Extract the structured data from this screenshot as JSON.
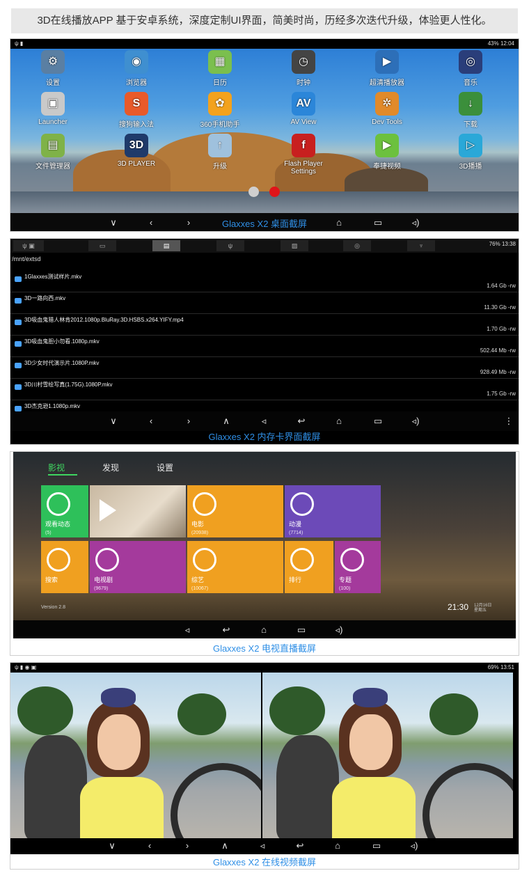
{
  "header": {
    "text": "3D在线播放APP 基于安卓系统，深度定制UI界面，简美时尚，历经多次迭代升级，体验更人性化。"
  },
  "desktop": {
    "status_right": "43% 12:04",
    "apps": [
      {
        "label": "设置",
        "icon": "gear-icon",
        "color": "#5a7fa3",
        "glyph": "⚙"
      },
      {
        "label": "浏览器",
        "icon": "globe-icon",
        "color": "#3f8fd0",
        "glyph": "◉"
      },
      {
        "label": "日历",
        "icon": "calendar-icon",
        "color": "#7bbf4e",
        "glyph": "▦"
      },
      {
        "label": "时钟",
        "icon": "clock-icon",
        "color": "#444444",
        "glyph": "◷"
      },
      {
        "label": "超清播放器",
        "icon": "clapper-icon",
        "color": "#2d6fb8",
        "glyph": "▶"
      },
      {
        "label": "音乐",
        "icon": "speaker-icon",
        "color": "#2a3e7a",
        "glyph": "◎"
      },
      {
        "label": "Launcher",
        "icon": "launcher-icon",
        "color": "#c9c9c9",
        "glyph": "▣"
      },
      {
        "label": "搜狗输入法",
        "icon": "sogou-icon",
        "color": "#e85a2a",
        "glyph": "S"
      },
      {
        "label": "360手机助手",
        "icon": "360-icon",
        "color": "#f3a21d",
        "glyph": "✿"
      },
      {
        "label": "AV View",
        "icon": "av-view-icon",
        "color": "#2b86d9",
        "glyph": "AV"
      },
      {
        "label": "Dev Tools",
        "icon": "dev-tools-icon",
        "color": "#e18a2a",
        "glyph": "✲"
      },
      {
        "label": "下载",
        "icon": "download-icon",
        "color": "#3b8f3b",
        "glyph": "↓"
      },
      {
        "label": "文件管理器",
        "icon": "folder-icon",
        "color": "#7fb248",
        "glyph": "▤"
      },
      {
        "label": "3D PLAYER",
        "icon": "3d-player-icon",
        "color": "#1f3a6a",
        "glyph": "3D"
      },
      {
        "label": "升级",
        "icon": "upgrade-icon",
        "color": "#9fc1dd",
        "glyph": "↑"
      },
      {
        "label": "Flash Player Settings",
        "icon": "flash-icon",
        "color": "#c8201f",
        "glyph": "f"
      },
      {
        "label": "奉捷视频",
        "icon": "video-app-icon",
        "color": "#6cc13e",
        "glyph": "▶"
      },
      {
        "label": "3D播播",
        "icon": "3d-bobo-icon",
        "color": "#2aa8d8",
        "glyph": "▷"
      }
    ],
    "page_dots": [
      {
        "color": "#cfcfcf"
      },
      {
        "color": "#e0141a"
      }
    ],
    "caption": "Glaxxes X2 桌面截屏"
  },
  "filelist": {
    "status_right": "76% 13:38",
    "path": "/mnt/extsd",
    "files": [
      {
        "name": "1Glaxxes测试样片.mkv",
        "size": "1.64 Gb",
        "perm": "-rw"
      },
      {
        "name": "3D一路向西.mkv",
        "size": "11.30 Gb",
        "perm": "-rw"
      },
      {
        "name": "3D吸血鬼猎人林肯2012.1080p.BluRay.3D.HSBS.x264.YIFY.mp4",
        "size": "1.70 Gb",
        "perm": "-rw"
      },
      {
        "name": "3D吸血鬼胆小勿看.1080p.mkv",
        "size": "502.44 Mb",
        "perm": "-rw"
      },
      {
        "name": "3D少女时代演示片.1080P.mkv",
        "size": "928.49 Mb",
        "perm": "-rw"
      },
      {
        "name": "3D川村雪绘写真(1.75G).1080P.mkv",
        "size": "1.75 Gb",
        "perm": "-rw"
      },
      {
        "name": "3D杰克逊1.1080p.mkv",
        "size": "",
        "perm": ""
      }
    ],
    "caption": "Glaxxes X2 内存卡界面截屏"
  },
  "tv": {
    "tabs": [
      "影视",
      "发现",
      "设置"
    ],
    "tiles": [
      {
        "label": "观看动态",
        "count": "(5)",
        "color": "#2ec05a"
      },
      {
        "label": "电影",
        "count": "(20938)",
        "color": "#f0a020"
      },
      {
        "label": "动漫",
        "count": "(7714)",
        "color": "#6c4ab8"
      },
      {
        "label": "搜索",
        "count": "",
        "color": "#f0a020"
      },
      {
        "label": "电视剧",
        "count": "(9679)",
        "color": "#a43a9c"
      },
      {
        "label": "综艺",
        "count": "(10067)",
        "color": "#f0a020"
      },
      {
        "label": "排行",
        "count": "",
        "color": "#f0a020"
      },
      {
        "label": "专题",
        "count": "(100)",
        "color": "#a43a9c"
      }
    ],
    "version": "Version 2.8",
    "clock": "21:30",
    "date_line1": "12月16日",
    "date_line2": "星期五",
    "caption": "Glaxxes X2 电视直播截屏"
  },
  "video": {
    "status_right": "69% 13:51",
    "caption": "Glaxxes X2 在线视频截屏"
  },
  "nav_icons": {
    "back": "∨",
    "left": "‹",
    "right": "›",
    "up": "∧",
    "vol_down": "◃",
    "return": "↩",
    "home": "⌂",
    "recent": "▭",
    "vol_up": "◃)"
  }
}
